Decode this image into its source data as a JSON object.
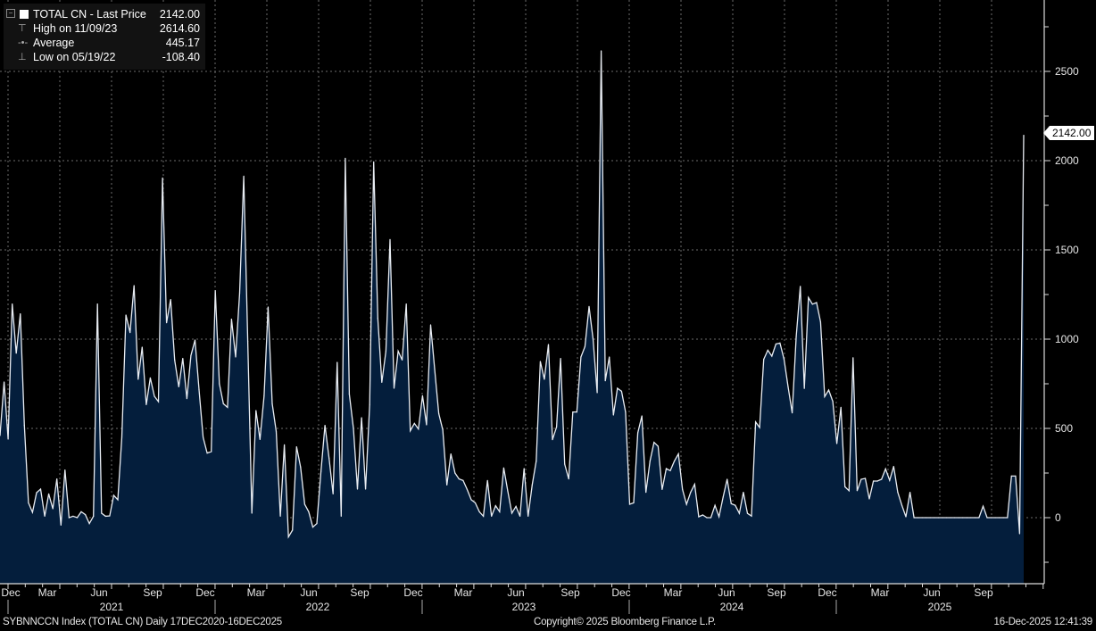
{
  "legend": {
    "series_label": "TOTAL CN - Last Price",
    "series_value": "2142.00",
    "high_label": "High on 11/09/23",
    "high_value": "2614.60",
    "avg_label": "Average",
    "avg_value": "445.17",
    "low_label": "Low on 05/19/22",
    "low_value": "-108.40"
  },
  "last_price_tag": "2142.00",
  "footer": {
    "left": "SYBNNCCN Index (TOTAL CN) Daily 17DEC2020-16DEC2025",
    "center": "Copyright© 2025 Bloomberg Finance L.P.",
    "right": "16-Dec-2025 12:41:39"
  },
  "colors": {
    "line": "#e8ecf2",
    "fill": "#041e3c",
    "background": "#000000",
    "grid": "#6b6b6b"
  },
  "chart_data": {
    "type": "area",
    "title": "TOTAL CN - Last Price",
    "x_start": "2020-12-17",
    "x_end": "2025-12-16",
    "frequency": "weekly",
    "ylim": [
      -370,
      2880
    ],
    "yticks": [
      "0",
      "500",
      "1000",
      "1500",
      "2000",
      "2500"
    ],
    "ytick_values": [
      0,
      500,
      1000,
      1500,
      2000,
      2500
    ],
    "month_ticks": [
      "Dec",
      "Mar",
      "Jun",
      "Sep",
      "Dec",
      "Mar",
      "Jun",
      "Sep",
      "Dec",
      "Mar",
      "Jun",
      "Sep",
      "Dec",
      "Mar",
      "Jun",
      "Sep",
      "Dec",
      "Mar",
      "Jun",
      "Sep"
    ],
    "year_ticks": [
      "2021",
      "2022",
      "2023",
      "2024",
      "2025"
    ],
    "grid": true,
    "values": [
      460,
      760,
      440,
      1197,
      921,
      1142,
      517,
      83,
      30,
      140,
      160,
      8,
      133,
      50,
      217,
      -42,
      267,
      0,
      8,
      0,
      33,
      17,
      -33,
      8,
      1197,
      25,
      8,
      10,
      125,
      100,
      450,
      1135,
      1037,
      1300,
      775,
      955,
      633,
      783,
      680,
      650,
      1903,
      1092,
      1222,
      883,
      733,
      892,
      667,
      908,
      995,
      717,
      450,
      362,
      370,
      1272,
      750,
      638,
      618,
      1112,
      900,
      1258,
      1913,
      987,
      25,
      600,
      438,
      683,
      1180,
      638,
      483,
      8,
      408,
      -108,
      -70,
      397,
      283,
      75,
      33,
      -53,
      -33,
      258,
      517,
      333,
      133,
      870,
      8,
      2013,
      692,
      500,
      160,
      560,
      160,
      633,
      1993,
      1117,
      758,
      933,
      1558,
      725,
      933,
      883,
      1197,
      487,
      528,
      497,
      683,
      520,
      1080,
      833,
      583,
      492,
      183,
      357,
      250,
      217,
      208,
      158,
      100,
      83,
      33,
      8,
      208,
      8,
      67,
      33,
      279,
      150,
      25,
      63,
      8,
      275,
      8,
      183,
      317,
      875,
      775,
      970,
      437,
      508,
      892,
      300,
      217,
      592,
      592,
      900,
      958,
      1183,
      1000,
      700,
      2615,
      767,
      900,
      575,
      725,
      708,
      592,
      75,
      83,
      475,
      570,
      142,
      317,
      422,
      400,
      158,
      275,
      263,
      317,
      357,
      158,
      75,
      142,
      187,
      5,
      15,
      0,
      0,
      69,
      5,
      115,
      215,
      78,
      69,
      24,
      142,
      24,
      9,
      536,
      505,
      887,
      938,
      905,
      973,
      978,
      887,
      733,
      587,
      1015,
      1296,
      724,
      1233,
      1196,
      1205,
      1096,
      678,
      715,
      651,
      415,
      618,
      173,
      151,
      896,
      151,
      215,
      220,
      105,
      205,
      205,
      215,
      273,
      209,
      287,
      142,
      69,
      5,
      142,
      0,
      0,
      0,
      0,
      0,
      0,
      0,
      0,
      0,
      0,
      0,
      0,
      0,
      0,
      0,
      0,
      0,
      64,
      0,
      0,
      0,
      0,
      0,
      0,
      233,
      233,
      -90,
      2142
    ]
  }
}
